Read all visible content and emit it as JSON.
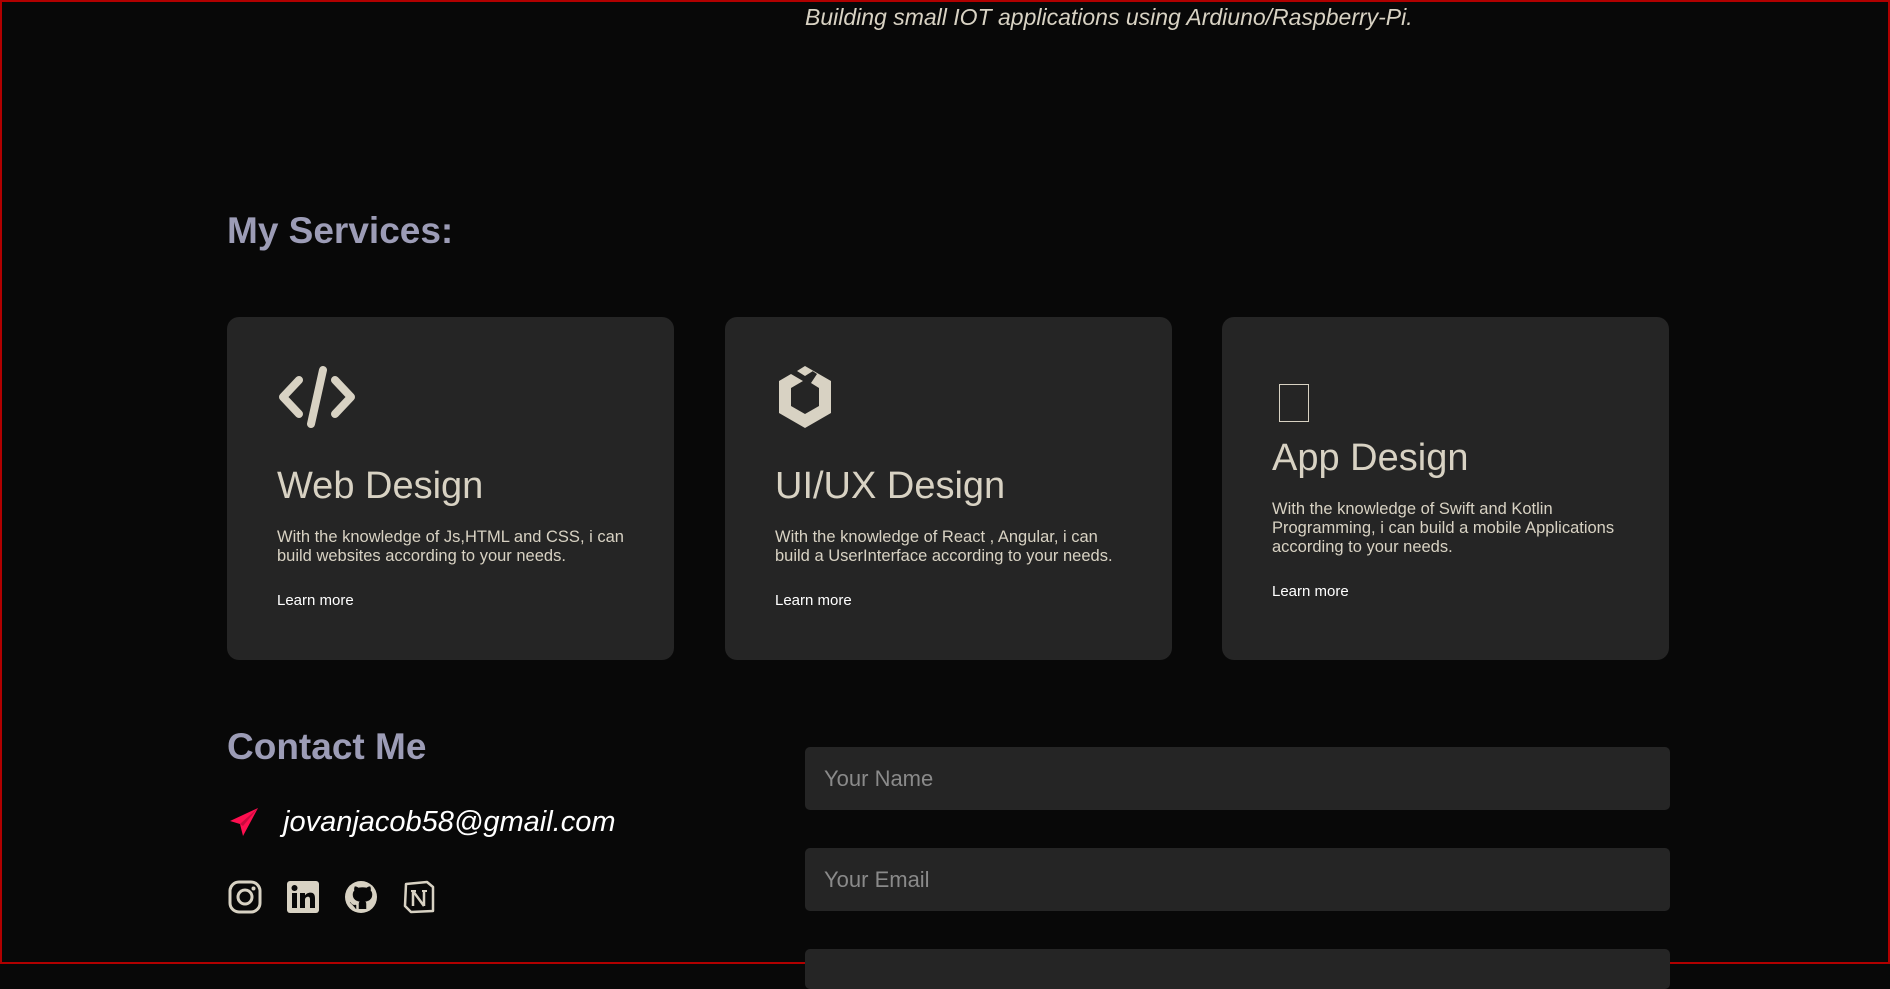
{
  "intro": {
    "line": "Building small IOT applications using Ardiuno/Raspberry-Pi."
  },
  "services": {
    "title": "My Services:",
    "cards": [
      {
        "icon": "code-icon",
        "title": "Web Design",
        "description": "With the knowledge of Js,HTML and CSS, i can build websites according to your needs.",
        "link": "Learn more"
      },
      {
        "icon": "uikit-icon",
        "title": "UI/UX Design",
        "description": "With the knowledge of React , Angular, i can build a UserInterface according to your needs.",
        "link": "Learn more"
      },
      {
        "icon": "mobile-icon",
        "title": "App Design",
        "description": "With the knowledge of Swift and Kotlin Programming, i can build a mobile Applications according to your needs.",
        "link": "Learn more"
      }
    ]
  },
  "contact": {
    "title": "Contact Me",
    "email": "jovanjacob58@gmail.com",
    "socials": [
      "instagram-icon",
      "linkedin-icon",
      "github-icon",
      "notion-icon"
    ],
    "form": {
      "name_placeholder": "Your Name",
      "email_placeholder": "Your Email",
      "message_placeholder": ""
    }
  },
  "colors": {
    "background": "#080808",
    "card": "#252525",
    "heading": "#9c9cb6",
    "text": "#d8d2c3",
    "accent": "#ff0f50"
  }
}
